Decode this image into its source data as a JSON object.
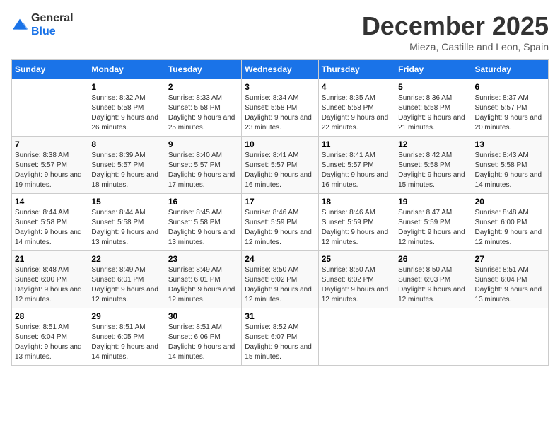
{
  "header": {
    "logo": {
      "line1": "General",
      "line2": "Blue"
    },
    "title": "December 2025",
    "subtitle": "Mieza, Castille and Leon, Spain"
  },
  "weekdays": [
    "Sunday",
    "Monday",
    "Tuesday",
    "Wednesday",
    "Thursday",
    "Friday",
    "Saturday"
  ],
  "weeks": [
    [
      {
        "day": "",
        "sunrise": "",
        "sunset": "",
        "daylight": ""
      },
      {
        "day": "1",
        "sunrise": "Sunrise: 8:32 AM",
        "sunset": "Sunset: 5:58 PM",
        "daylight": "Daylight: 9 hours and 26 minutes."
      },
      {
        "day": "2",
        "sunrise": "Sunrise: 8:33 AM",
        "sunset": "Sunset: 5:58 PM",
        "daylight": "Daylight: 9 hours and 25 minutes."
      },
      {
        "day": "3",
        "sunrise": "Sunrise: 8:34 AM",
        "sunset": "Sunset: 5:58 PM",
        "daylight": "Daylight: 9 hours and 23 minutes."
      },
      {
        "day": "4",
        "sunrise": "Sunrise: 8:35 AM",
        "sunset": "Sunset: 5:58 PM",
        "daylight": "Daylight: 9 hours and 22 minutes."
      },
      {
        "day": "5",
        "sunrise": "Sunrise: 8:36 AM",
        "sunset": "Sunset: 5:58 PM",
        "daylight": "Daylight: 9 hours and 21 minutes."
      },
      {
        "day": "6",
        "sunrise": "Sunrise: 8:37 AM",
        "sunset": "Sunset: 5:57 PM",
        "daylight": "Daylight: 9 hours and 20 minutes."
      }
    ],
    [
      {
        "day": "7",
        "sunrise": "Sunrise: 8:38 AM",
        "sunset": "Sunset: 5:57 PM",
        "daylight": "Daylight: 9 hours and 19 minutes."
      },
      {
        "day": "8",
        "sunrise": "Sunrise: 8:39 AM",
        "sunset": "Sunset: 5:57 PM",
        "daylight": "Daylight: 9 hours and 18 minutes."
      },
      {
        "day": "9",
        "sunrise": "Sunrise: 8:40 AM",
        "sunset": "Sunset: 5:57 PM",
        "daylight": "Daylight: 9 hours and 17 minutes."
      },
      {
        "day": "10",
        "sunrise": "Sunrise: 8:41 AM",
        "sunset": "Sunset: 5:57 PM",
        "daylight": "Daylight: 9 hours and 16 minutes."
      },
      {
        "day": "11",
        "sunrise": "Sunrise: 8:41 AM",
        "sunset": "Sunset: 5:57 PM",
        "daylight": "Daylight: 9 hours and 16 minutes."
      },
      {
        "day": "12",
        "sunrise": "Sunrise: 8:42 AM",
        "sunset": "Sunset: 5:58 PM",
        "daylight": "Daylight: 9 hours and 15 minutes."
      },
      {
        "day": "13",
        "sunrise": "Sunrise: 8:43 AM",
        "sunset": "Sunset: 5:58 PM",
        "daylight": "Daylight: 9 hours and 14 minutes."
      }
    ],
    [
      {
        "day": "14",
        "sunrise": "Sunrise: 8:44 AM",
        "sunset": "Sunset: 5:58 PM",
        "daylight": "Daylight: 9 hours and 14 minutes."
      },
      {
        "day": "15",
        "sunrise": "Sunrise: 8:44 AM",
        "sunset": "Sunset: 5:58 PM",
        "daylight": "Daylight: 9 hours and 13 minutes."
      },
      {
        "day": "16",
        "sunrise": "Sunrise: 8:45 AM",
        "sunset": "Sunset: 5:58 PM",
        "daylight": "Daylight: 9 hours and 13 minutes."
      },
      {
        "day": "17",
        "sunrise": "Sunrise: 8:46 AM",
        "sunset": "Sunset: 5:59 PM",
        "daylight": "Daylight: 9 hours and 12 minutes."
      },
      {
        "day": "18",
        "sunrise": "Sunrise: 8:46 AM",
        "sunset": "Sunset: 5:59 PM",
        "daylight": "Daylight: 9 hours and 12 minutes."
      },
      {
        "day": "19",
        "sunrise": "Sunrise: 8:47 AM",
        "sunset": "Sunset: 5:59 PM",
        "daylight": "Daylight: 9 hours and 12 minutes."
      },
      {
        "day": "20",
        "sunrise": "Sunrise: 8:48 AM",
        "sunset": "Sunset: 6:00 PM",
        "daylight": "Daylight: 9 hours and 12 minutes."
      }
    ],
    [
      {
        "day": "21",
        "sunrise": "Sunrise: 8:48 AM",
        "sunset": "Sunset: 6:00 PM",
        "daylight": "Daylight: 9 hours and 12 minutes."
      },
      {
        "day": "22",
        "sunrise": "Sunrise: 8:49 AM",
        "sunset": "Sunset: 6:01 PM",
        "daylight": "Daylight: 9 hours and 12 minutes."
      },
      {
        "day": "23",
        "sunrise": "Sunrise: 8:49 AM",
        "sunset": "Sunset: 6:01 PM",
        "daylight": "Daylight: 9 hours and 12 minutes."
      },
      {
        "day": "24",
        "sunrise": "Sunrise: 8:50 AM",
        "sunset": "Sunset: 6:02 PM",
        "daylight": "Daylight: 9 hours and 12 minutes."
      },
      {
        "day": "25",
        "sunrise": "Sunrise: 8:50 AM",
        "sunset": "Sunset: 6:02 PM",
        "daylight": "Daylight: 9 hours and 12 minutes."
      },
      {
        "day": "26",
        "sunrise": "Sunrise: 8:50 AM",
        "sunset": "Sunset: 6:03 PM",
        "daylight": "Daylight: 9 hours and 12 minutes."
      },
      {
        "day": "27",
        "sunrise": "Sunrise: 8:51 AM",
        "sunset": "Sunset: 6:04 PM",
        "daylight": "Daylight: 9 hours and 13 minutes."
      }
    ],
    [
      {
        "day": "28",
        "sunrise": "Sunrise: 8:51 AM",
        "sunset": "Sunset: 6:04 PM",
        "daylight": "Daylight: 9 hours and 13 minutes."
      },
      {
        "day": "29",
        "sunrise": "Sunrise: 8:51 AM",
        "sunset": "Sunset: 6:05 PM",
        "daylight": "Daylight: 9 hours and 14 minutes."
      },
      {
        "day": "30",
        "sunrise": "Sunrise: 8:51 AM",
        "sunset": "Sunset: 6:06 PM",
        "daylight": "Daylight: 9 hours and 14 minutes."
      },
      {
        "day": "31",
        "sunrise": "Sunrise: 8:52 AM",
        "sunset": "Sunset: 6:07 PM",
        "daylight": "Daylight: 9 hours and 15 minutes."
      },
      {
        "day": "",
        "sunrise": "",
        "sunset": "",
        "daylight": ""
      },
      {
        "day": "",
        "sunrise": "",
        "sunset": "",
        "daylight": ""
      },
      {
        "day": "",
        "sunrise": "",
        "sunset": "",
        "daylight": ""
      }
    ]
  ]
}
